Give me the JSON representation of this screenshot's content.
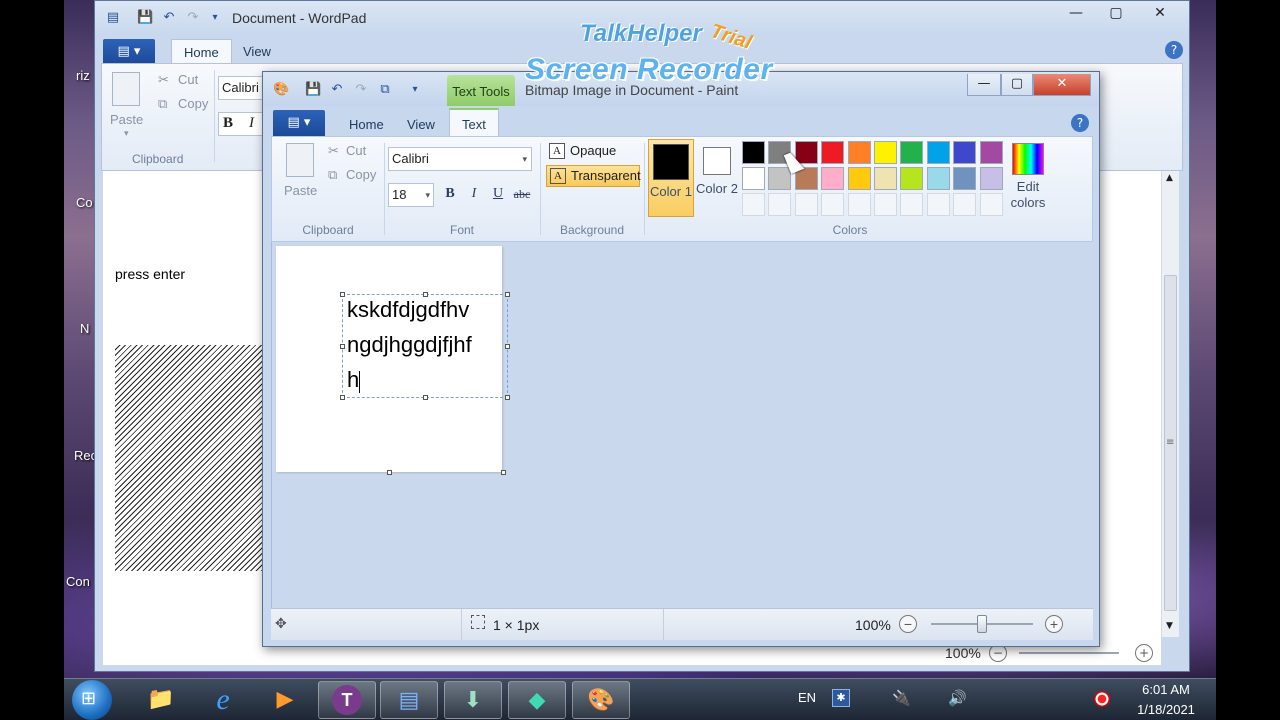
{
  "watermark": {
    "brand": "TalkHelper",
    "trial": "Trial",
    "product": "Screen Recorder"
  },
  "desktop": {
    "labels": [
      "riz",
      "Co",
      "N",
      "Rec",
      "Con"
    ]
  },
  "wordpad": {
    "title": "Document - WordPad",
    "tabs": [
      "Home",
      "View"
    ],
    "ribbon": {
      "paste": "Paste",
      "cut": "Cut",
      "copy": "Copy",
      "clipboard": "Clipboard",
      "font": "Calibri",
      "bold": "B",
      "italic": "I"
    },
    "doc_text": "press enter",
    "zoom": "100%"
  },
  "paint": {
    "title": "Bitmap Image in Document - Paint",
    "context_tab": "Text Tools",
    "tabs": [
      "Home",
      "View",
      "Text"
    ],
    "clipboard": {
      "paste": "Paste",
      "cut": "Cut",
      "copy": "Copy",
      "label": "Clipboard"
    },
    "font": {
      "family": "Calibri",
      "size": "18",
      "bold": "B",
      "italic": "I",
      "underline": "U",
      "strike": "abc",
      "label": "Font"
    },
    "background": {
      "opaque": "Opaque",
      "transparent": "Transparent",
      "label": "Background"
    },
    "colors": {
      "color1": "Color 1",
      "color2": "Color 2",
      "edit": "Edit colors",
      "label": "Colors",
      "color1_value": "#000000",
      "color2_value": "#ffffff",
      "row1": [
        "#000000",
        "#7f7f7f",
        "#880015",
        "#ed1c24",
        "#ff7f27",
        "#fff200",
        "#22b14c",
        "#00a2e8",
        "#3f48cc",
        "#a349a4"
      ],
      "row2": [
        "#ffffff",
        "#c3c3c3",
        "#b97a57",
        "#ffaec9",
        "#ffc90e",
        "#efe4b0",
        "#b5e61d",
        "#99d9ea",
        "#7092be",
        "#c8bfe7"
      ]
    },
    "text_lines": [
      "kskdfdjgdfhv",
      "ngdjhggdjfjhf",
      "h"
    ],
    "status": {
      "size": "1 × 1px",
      "zoom": "100%",
      "zoom_level": 0.5
    }
  },
  "taskbar": {
    "lang": "EN",
    "time": "6:01 AM",
    "date": "1/18/2021",
    "buttons": [
      "start-orb",
      "explorer",
      "internet-explorer",
      "media-player",
      "talkhelper",
      "wordpad",
      "installer",
      "filmora",
      "paint"
    ]
  }
}
